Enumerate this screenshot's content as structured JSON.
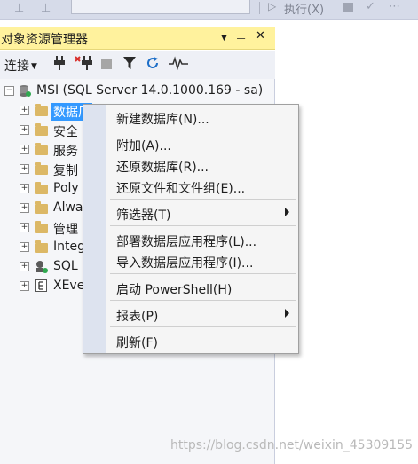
{
  "toolbar": {
    "execute_label": "执行(X)"
  },
  "panel": {
    "title": "对象资源管理器",
    "pin_glyph": "▼",
    "dock_glyph": "⊥",
    "close_glyph": "✕"
  },
  "explorer_toolbar": {
    "connect_label": "连接",
    "connect_caret": "▼"
  },
  "tree": {
    "server": "MSI (SQL Server 14.0.1000.169 - sa)",
    "items": [
      {
        "label": "数据库"
      },
      {
        "label": "安全性"
      },
      {
        "label": "服务器对象"
      },
      {
        "label": "复制"
      },
      {
        "label": "PolyBase"
      },
      {
        "label": "AlwaysOn 高可用性"
      },
      {
        "label": "管理"
      },
      {
        "label": "Integration Services 目录"
      },
      {
        "label": "SQL Server 代理"
      },
      {
        "label": "XEvent 探查器"
      }
    ],
    "visible_labels": [
      "数据厂",
      "安全",
      "服务",
      "复制",
      "Poly",
      "Alwa",
      "管理",
      "Integ",
      "SQL",
      "XEve"
    ]
  },
  "context_menu": {
    "items": [
      {
        "label": "新建数据库(N)...",
        "submenu": false
      },
      {
        "label": "附加(A)...",
        "submenu": false
      },
      {
        "label": "还原数据库(R)...",
        "submenu": false
      },
      {
        "label": "还原文件和文件组(E)...",
        "submenu": false
      },
      {
        "label": "筛选器(T)",
        "submenu": true
      },
      {
        "label": "部署数据层应用程序(L)...",
        "submenu": false
      },
      {
        "label": "导入数据层应用程序(I)...",
        "submenu": false
      },
      {
        "label": "启动 PowerShell(H)",
        "submenu": false
      },
      {
        "label": "报表(P)",
        "submenu": true
      },
      {
        "label": "刷新(F)",
        "submenu": false
      }
    ]
  },
  "watermark": "https://blog.csdn.net/weixin_45309155",
  "colors": {
    "title_bar": "#fff29d",
    "selection": "#3399ff",
    "menu_gutter": "#dde3ef",
    "folder": "#dcb866"
  }
}
